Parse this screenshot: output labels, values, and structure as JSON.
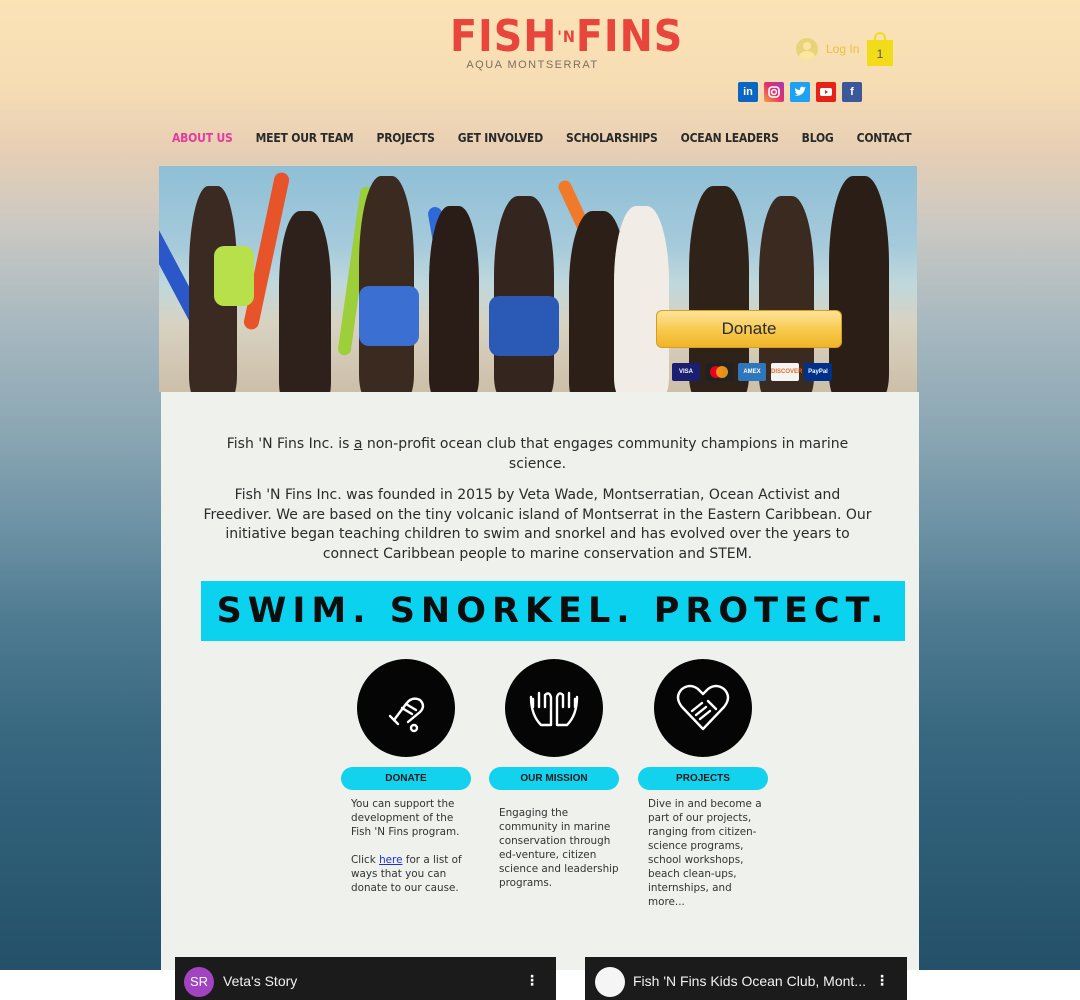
{
  "logo": {
    "part1": "FISH",
    "part2": "'N",
    "part3": "FINS",
    "subtitle": "AQUA MONTSERRAT"
  },
  "header": {
    "login_label": "Log In",
    "cart_count": "1"
  },
  "social": [
    "in",
    "ig",
    "t",
    "yt",
    "f"
  ],
  "nav": [
    "ABOUT US",
    "MEET OUR TEAM",
    "PROJECTS",
    "GET INVOLVED",
    "SCHOLARSHIPS",
    "OCEAN LEADERS",
    "BLOG",
    "CONTACT"
  ],
  "hero": {
    "donate_label": "Donate",
    "payment_cards": [
      "VISA",
      "MC",
      "AMEX",
      "DISCOVER",
      "PayPal"
    ]
  },
  "intro": {
    "p1_before": "Fish 'N Fins Inc. is ",
    "p1_underlined": "a",
    "p1_after": " non-profit ocean club that engages community champions in marine science.",
    "p2": "Fish 'N Fins Inc. was founded in 2015 by Veta Wade, Montserratian, Ocean Activist and Freediver. We are based on the tiny volcanic island of Montserrat in the Eastern Caribbean. Our initiative began teaching children to swim and snorkel and has evolved over the years to connect Caribbean people to marine conservation and STEM."
  },
  "banner": "SWIM. SNORKEL. PROTECT.",
  "columns": {
    "donate": {
      "label": "DONATE",
      "text1": "You can support the development of the Fish 'N Fins program.",
      "text2_before": "Click ",
      "link": "here",
      "text2_after": " for a list of ways that you can donate to our cause."
    },
    "mission": {
      "label": "OUR MISSION",
      "text": "Engaging the community in marine conservation through ed-venture, citizen science and leadership programs."
    },
    "projects": {
      "label": "PROJECTS",
      "text": "Dive in and become a part of our projects, ranging from citizen-science programs, school workshops, beach clean-ups, internships, and more..."
    }
  },
  "videos": [
    {
      "avatar": "SR",
      "title": "Veta's Story"
    },
    {
      "title": "Fish 'N Fins Kids Ocean Club, Mont..."
    }
  ],
  "colors": {
    "accent_pink": "#e33ba0",
    "banner_cyan": "#0bd3ef",
    "pill_cyan": "#12d2ee",
    "panel_bg": "#eef1ec"
  }
}
